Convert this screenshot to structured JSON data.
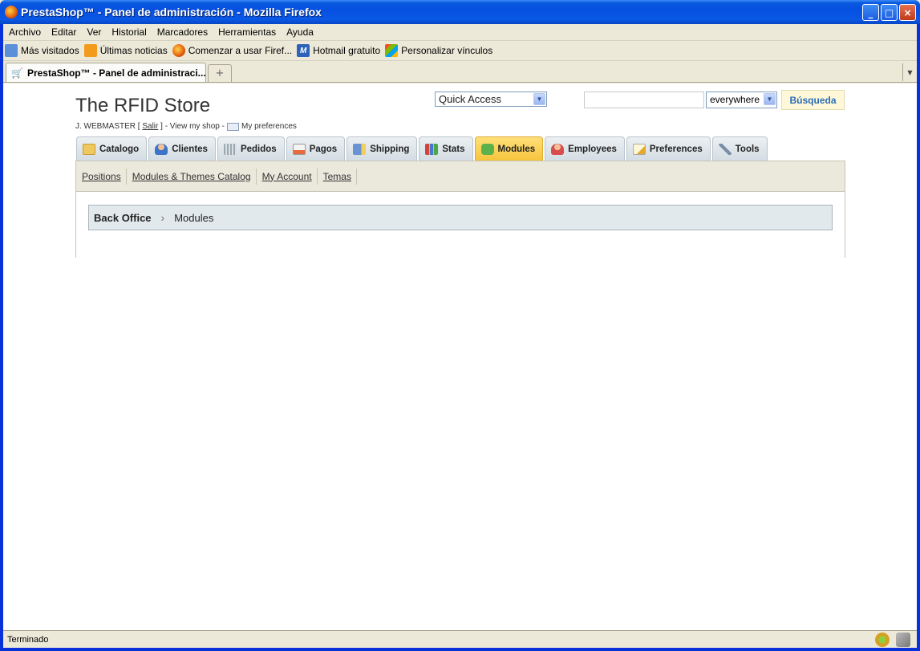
{
  "window": {
    "title": "PrestaShop™ - Panel de administración - Mozilla Firefox",
    "buttons": {
      "minimize": "_",
      "maximize": "□",
      "close": "×"
    }
  },
  "menubar": [
    "Archivo",
    "Editar",
    "Ver",
    "Historial",
    "Marcadores",
    "Herramientas",
    "Ayuda"
  ],
  "bookmarks": [
    {
      "label": "Más visitados",
      "icon": "most-visited-icon"
    },
    {
      "label": "Últimas noticias",
      "icon": "rss-icon"
    },
    {
      "label": "Comenzar a usar Firef...",
      "icon": "firefox-icon"
    },
    {
      "label": "Hotmail gratuito",
      "icon": "hotmail-icon"
    },
    {
      "label": "Personalizar vínculos",
      "icon": "windows-icon"
    }
  ],
  "browser_tab": {
    "label": "PrestaShop™ - Panel de administraci...",
    "new_tab": "+",
    "list_arrow": "▼"
  },
  "header": {
    "store_name": "The RFID Store",
    "user": "J. WEBMASTER [",
    "logout": "Salir",
    "user_tail": "] - View my shop -",
    "preferences": "My preferences",
    "quick_access": "Quick Access",
    "search_value": "",
    "search_scope": "everywhere",
    "search_button": "Búsqueda"
  },
  "admin_tabs": [
    {
      "label": "Catalogo",
      "icon": "folder-icon",
      "active": false
    },
    {
      "label": "Clientes",
      "icon": "customer-icon",
      "active": false
    },
    {
      "label": "Pedidos",
      "icon": "orders-icon",
      "active": false
    },
    {
      "label": "Pagos",
      "icon": "payment-icon",
      "active": false
    },
    {
      "label": "Shipping",
      "icon": "truck-icon",
      "active": false
    },
    {
      "label": "Stats",
      "icon": "stats-icon",
      "active": false
    },
    {
      "label": "Modules",
      "icon": "puzzle-icon",
      "active": true
    },
    {
      "label": "Employees",
      "icon": "employee-icon",
      "active": false
    },
    {
      "label": "Preferences",
      "icon": "preferences-icon",
      "active": false
    },
    {
      "label": "Tools",
      "icon": "wrench-icon",
      "active": false
    }
  ],
  "subnav": [
    "Positions",
    "Modules & Themes Catalog",
    "My Account",
    "Temas"
  ],
  "breadcrumb": {
    "root": "Back Office",
    "separator": "›",
    "current": "Modules"
  },
  "status": {
    "text": "Terminado"
  },
  "colors": {
    "active_tab": "#f6c43c",
    "breadcrumb_bg": "#e1e9ed",
    "search_button_text": "#2a6cb8"
  }
}
